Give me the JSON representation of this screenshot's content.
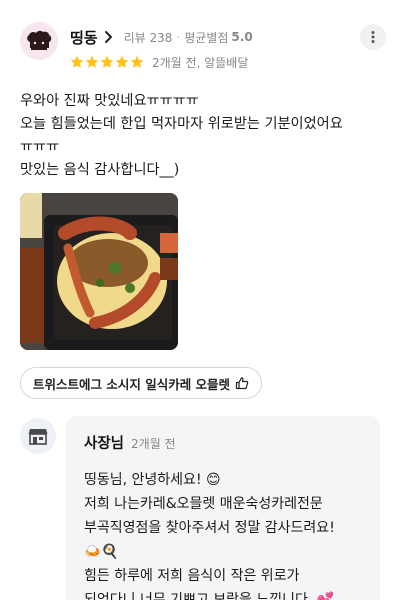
{
  "review": {
    "user_name": "띵동",
    "review_count": "리뷰 238",
    "separator": "·",
    "avg_label": "평균별점",
    "avg_value": "5.0",
    "rating": 5,
    "rating_meta": "2개월 전, 알뜰배달",
    "text_lines": [
      "우와아 진짜 맛있네요ㅠㅠㅠㅠ",
      "오늘 힘들었는데 한입 먹자마자 위로받는 기분이었어요",
      "ㅠㅠㅠ",
      "맛있는 음식 감사합니다__)"
    ],
    "menu_chip": "트위스트에그 소시지 일식카레 오믈렛"
  },
  "owner": {
    "name": "사장님",
    "time": "2개월 전",
    "text_lines": [
      "띵동님, 안녕하세요! 😊",
      "저희 나는카레&오믈렛 매운숙성카레전문",
      "부곡직영점을 찾아주셔서 정말 감사드려요!",
      "🍛🍳",
      "힘든 하루에 저희 음식이 작은 위로가",
      "되었다니 너무 기쁘고 보람을 느낍니다. 💕"
    ]
  },
  "colors": {
    "star": "#ffc21a",
    "muted_text": "#888888",
    "bubble_bg": "#f4f5f7"
  },
  "icons": [
    "chevron-right-icon",
    "more-vertical-icon",
    "star-icon",
    "thumbs-up-icon",
    "store-icon"
  ]
}
